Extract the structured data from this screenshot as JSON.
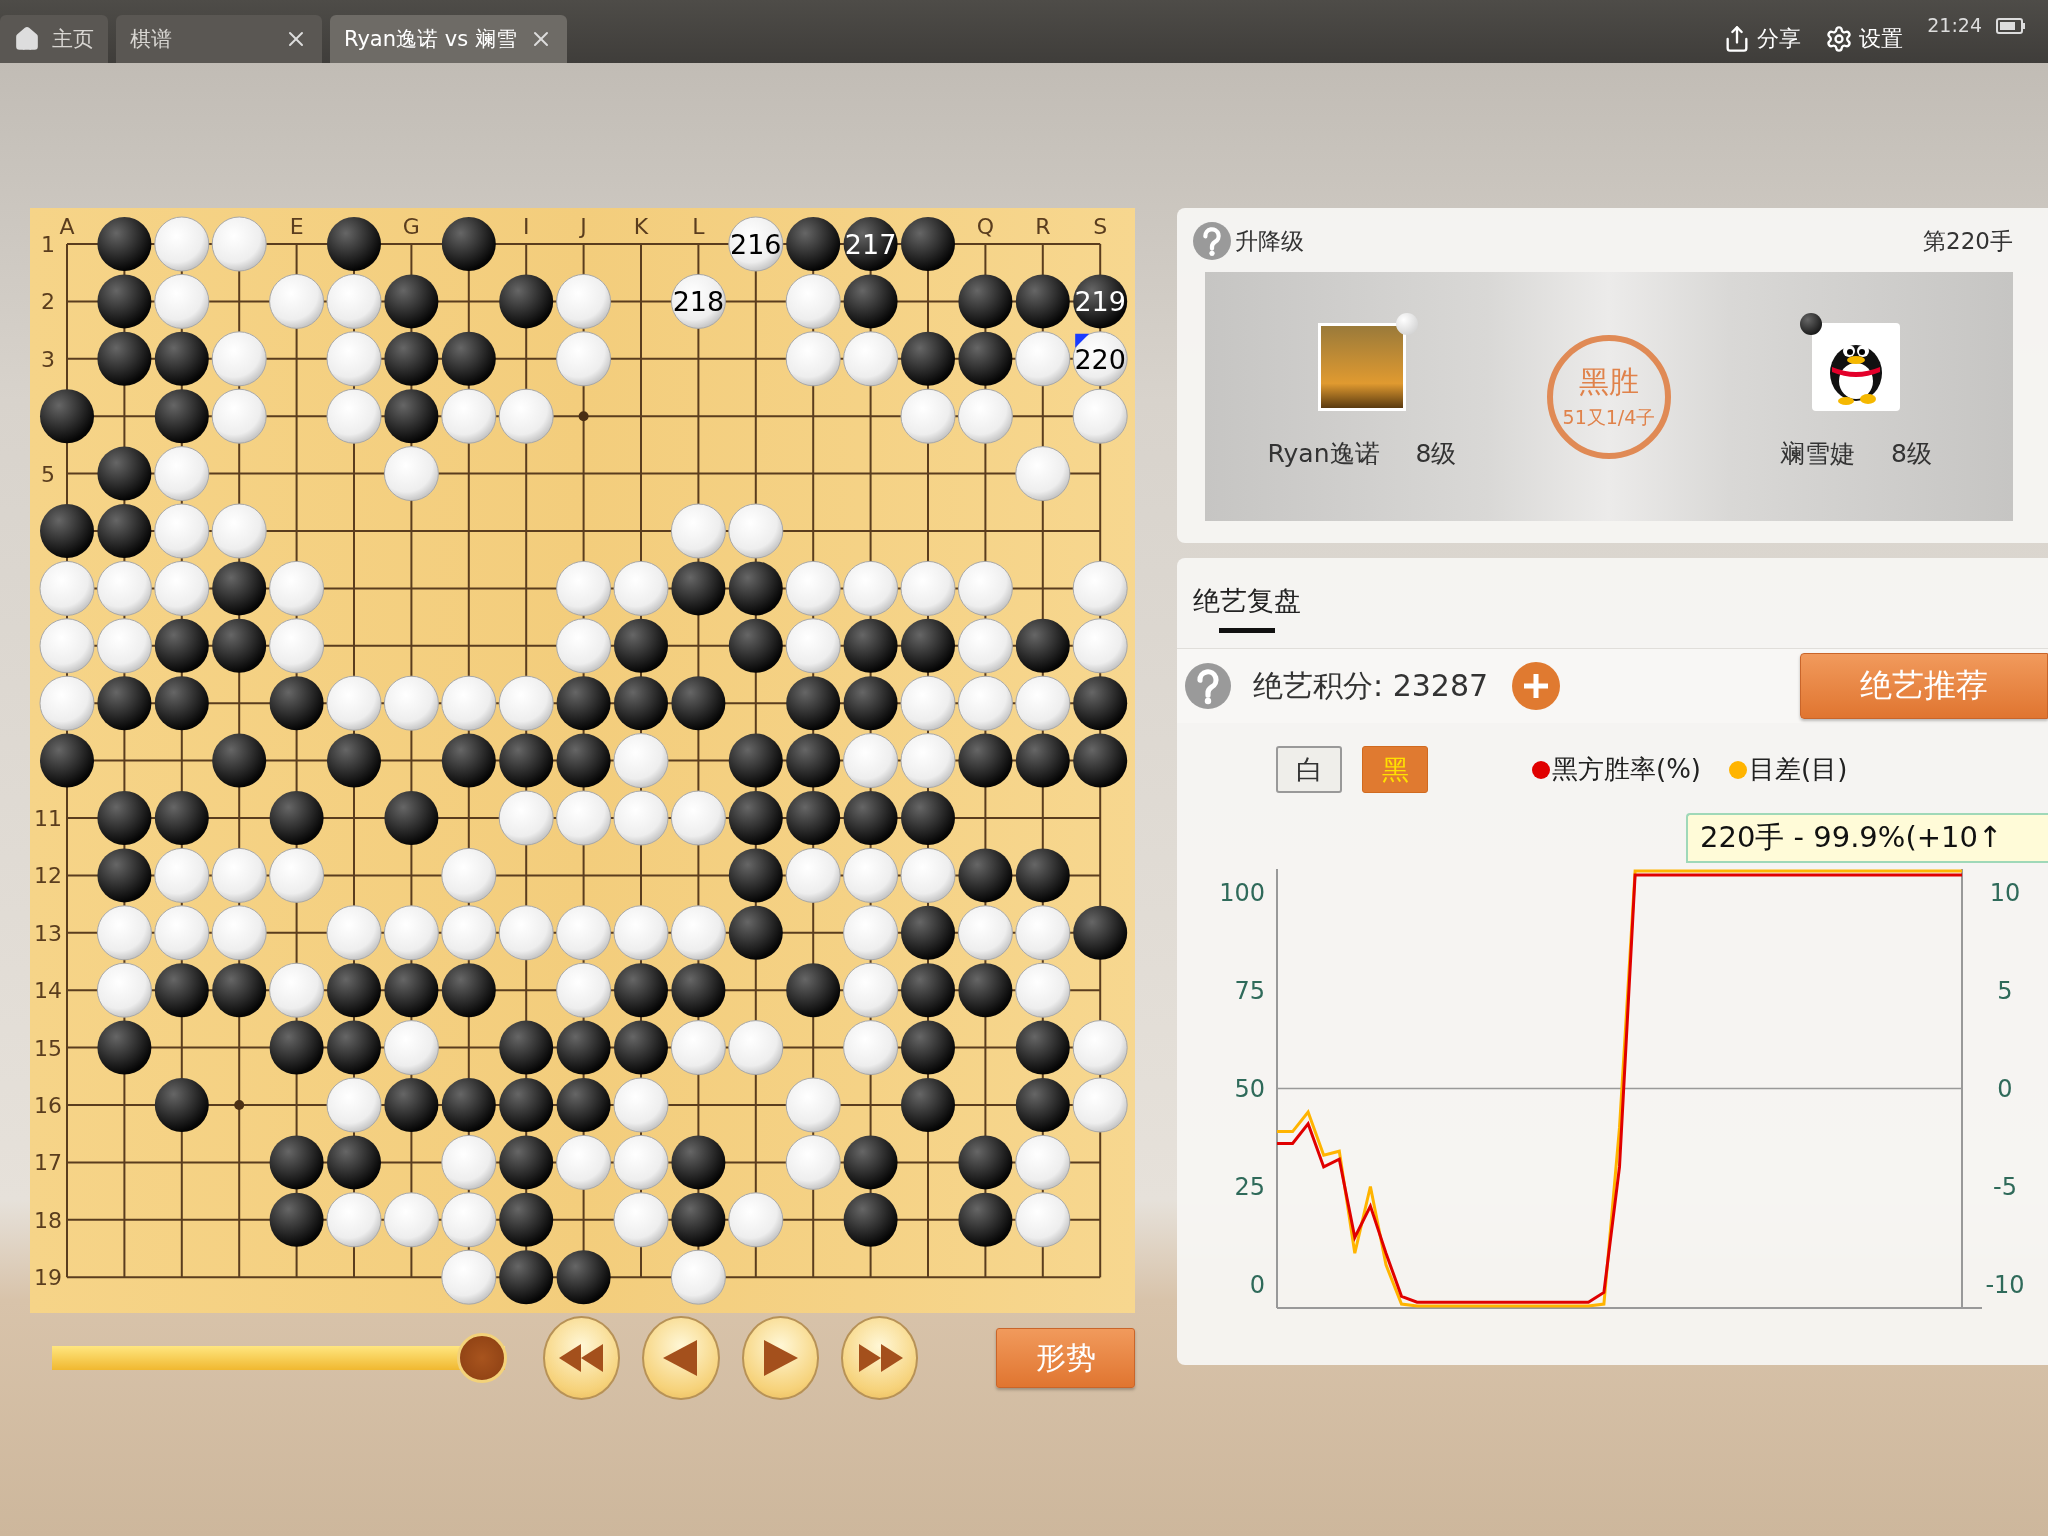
{
  "tabs": [
    {
      "kind": "home",
      "label": "主页",
      "selected": false,
      "closable": false
    },
    {
      "kind": "page",
      "label": "棋谱",
      "selected": false,
      "closable": true
    },
    {
      "kind": "page",
      "label": "Ryan逸诺 vs 斓雪",
      "selected": true,
      "closable": true
    }
  ],
  "toolbar": [
    {
      "kind": "share",
      "label": "分享"
    },
    {
      "kind": "settings",
      "label": "设置"
    }
  ],
  "status": {
    "time": "21:24"
  },
  "board": {
    "column_labels": [
      {
        "kind": "label",
        "text": "A"
      },
      {
        "kind": "covered"
      },
      {
        "kind": "covered"
      },
      {
        "kind": "covered"
      },
      {
        "kind": "label",
        "text": "E"
      },
      {
        "kind": "covered"
      },
      {
        "kind": "label",
        "text": "G"
      },
      {
        "kind": "covered"
      },
      {
        "kind": "label",
        "text": "I"
      },
      {
        "kind": "label",
        "text": "J"
      },
      {
        "kind": "label",
        "text": "K"
      },
      {
        "kind": "label",
        "text": "L"
      },
      {
        "kind": "covered"
      },
      {
        "kind": "covered"
      },
      {
        "kind": "covered"
      },
      {
        "kind": "covered"
      },
      {
        "kind": "label",
        "text": "Q"
      },
      {
        "kind": "label",
        "text": "R"
      },
      {
        "kind": "label",
        "text": "S"
      }
    ],
    "row_labels": [
      {
        "kind": "label",
        "text": "1"
      },
      {
        "kind": "label",
        "text": "2"
      },
      {
        "kind": "label",
        "text": "3"
      },
      {
        "kind": "covered"
      },
      {
        "kind": "label",
        "text": "5"
      },
      {
        "kind": "covered"
      },
      {
        "kind": "covered"
      },
      {
        "kind": "covered"
      },
      {
        "kind": "covered"
      },
      {
        "kind": "covered"
      },
      {
        "kind": "label",
        "text": "11"
      },
      {
        "kind": "label",
        "text": "12"
      },
      {
        "kind": "label",
        "text": "13"
      },
      {
        "kind": "label",
        "text": "14"
      },
      {
        "kind": "label",
        "text": "15"
      },
      {
        "kind": "label",
        "text": "16"
      },
      {
        "kind": "label",
        "text": "17"
      },
      {
        "kind": "label",
        "text": "18"
      },
      {
        "kind": "label",
        "text": "19"
      }
    ],
    "rows": [
      {
        "cells": [
          {
            "kind": "empty"
          },
          {
            "kind": "black"
          },
          {
            "kind": "white"
          },
          {
            "kind": "white"
          },
          {
            "kind": "empty"
          },
          {
            "kind": "black"
          },
          {
            "kind": "empty"
          },
          {
            "kind": "black"
          },
          {
            "kind": "empty"
          },
          {
            "kind": "empty"
          },
          {
            "kind": "empty"
          },
          {
            "kind": "empty"
          },
          {
            "kind": "white",
            "number": "216"
          },
          {
            "kind": "black"
          },
          {
            "kind": "black",
            "number": "217"
          },
          {
            "kind": "black"
          },
          {
            "kind": "empty"
          },
          {
            "kind": "empty"
          },
          {
            "kind": "empty"
          }
        ]
      },
      {
        "cells": [
          {
            "kind": "empty"
          },
          {
            "kind": "black"
          },
          {
            "kind": "white"
          },
          {
            "kind": "empty"
          },
          {
            "kind": "white"
          },
          {
            "kind": "white"
          },
          {
            "kind": "black"
          },
          {
            "kind": "empty"
          },
          {
            "kind": "black"
          },
          {
            "kind": "white"
          },
          {
            "kind": "empty"
          },
          {
            "kind": "white",
            "number": "218"
          },
          {
            "kind": "empty"
          },
          {
            "kind": "white"
          },
          {
            "kind": "black"
          },
          {
            "kind": "empty"
          },
          {
            "kind": "black"
          },
          {
            "kind": "black"
          },
          {
            "kind": "black",
            "number": "219"
          }
        ]
      },
      {
        "cells": [
          {
            "kind": "empty"
          },
          {
            "kind": "black"
          },
          {
            "kind": "black"
          },
          {
            "kind": "white"
          },
          {
            "kind": "empty"
          },
          {
            "kind": "white"
          },
          {
            "kind": "black"
          },
          {
            "kind": "black"
          },
          {
            "kind": "empty"
          },
          {
            "kind": "white"
          },
          {
            "kind": "empty"
          },
          {
            "kind": "empty"
          },
          {
            "kind": "empty"
          },
          {
            "kind": "white"
          },
          {
            "kind": "white"
          },
          {
            "kind": "black"
          },
          {
            "kind": "black"
          },
          {
            "kind": "white"
          },
          {
            "kind": "white",
            "number": "220",
            "marked": true
          }
        ]
      },
      {
        "cells": [
          {
            "kind": "black"
          },
          {
            "kind": "empty"
          },
          {
            "kind": "black"
          },
          {
            "kind": "white"
          },
          {
            "kind": "empty"
          },
          {
            "kind": "white"
          },
          {
            "kind": "black"
          },
          {
            "kind": "white"
          },
          {
            "kind": "white"
          },
          {
            "kind": "empty"
          },
          {
            "kind": "empty"
          },
          {
            "kind": "empty"
          },
          {
            "kind": "empty"
          },
          {
            "kind": "empty"
          },
          {
            "kind": "empty"
          },
          {
            "kind": "white"
          },
          {
            "kind": "white"
          },
          {
            "kind": "empty"
          },
          {
            "kind": "white"
          }
        ]
      },
      {
        "cells": [
          {
            "kind": "empty"
          },
          {
            "kind": "black"
          },
          {
            "kind": "white"
          },
          {
            "kind": "empty"
          },
          {
            "kind": "empty"
          },
          {
            "kind": "empty"
          },
          {
            "kind": "white"
          },
          {
            "kind": "empty"
          },
          {
            "kind": "empty"
          },
          {
            "kind": "empty"
          },
          {
            "kind": "empty"
          },
          {
            "kind": "empty"
          },
          {
            "kind": "empty"
          },
          {
            "kind": "empty"
          },
          {
            "kind": "empty"
          },
          {
            "kind": "empty"
          },
          {
            "kind": "empty"
          },
          {
            "kind": "white"
          },
          {
            "kind": "empty"
          }
        ]
      },
      {
        "cells": [
          {
            "kind": "black"
          },
          {
            "kind": "black"
          },
          {
            "kind": "white"
          },
          {
            "kind": "white"
          },
          {
            "kind": "empty"
          },
          {
            "kind": "empty"
          },
          {
            "kind": "empty"
          },
          {
            "kind": "empty"
          },
          {
            "kind": "empty"
          },
          {
            "kind": "empty"
          },
          {
            "kind": "empty"
          },
          {
            "kind": "white"
          },
          {
            "kind": "white"
          },
          {
            "kind": "empty"
          },
          {
            "kind": "empty"
          },
          {
            "kind": "empty"
          },
          {
            "kind": "empty"
          },
          {
            "kind": "empty"
          },
          {
            "kind": "empty"
          }
        ]
      },
      {
        "cells": [
          {
            "kind": "white"
          },
          {
            "kind": "white"
          },
          {
            "kind": "white"
          },
          {
            "kind": "black"
          },
          {
            "kind": "white"
          },
          {
            "kind": "empty"
          },
          {
            "kind": "empty"
          },
          {
            "kind": "empty"
          },
          {
            "kind": "empty"
          },
          {
            "kind": "white"
          },
          {
            "kind": "white"
          },
          {
            "kind": "black"
          },
          {
            "kind": "black"
          },
          {
            "kind": "white"
          },
          {
            "kind": "white"
          },
          {
            "kind": "white"
          },
          {
            "kind": "white"
          },
          {
            "kind": "empty"
          },
          {
            "kind": "white"
          }
        ]
      },
      {
        "cells": [
          {
            "kind": "white"
          },
          {
            "kind": "white"
          },
          {
            "kind": "black"
          },
          {
            "kind": "black"
          },
          {
            "kind": "white"
          },
          {
            "kind": "empty"
          },
          {
            "kind": "empty"
          },
          {
            "kind": "empty"
          },
          {
            "kind": "empty"
          },
          {
            "kind": "white"
          },
          {
            "kind": "black"
          },
          {
            "kind": "empty"
          },
          {
            "kind": "black"
          },
          {
            "kind": "white"
          },
          {
            "kind": "black"
          },
          {
            "kind": "black"
          },
          {
            "kind": "white"
          },
          {
            "kind": "black"
          },
          {
            "kind": "white"
          }
        ]
      },
      {
        "cells": [
          {
            "kind": "white"
          },
          {
            "kind": "black"
          },
          {
            "kind": "black"
          },
          {
            "kind": "empty"
          },
          {
            "kind": "black"
          },
          {
            "kind": "white"
          },
          {
            "kind": "white"
          },
          {
            "kind": "white"
          },
          {
            "kind": "white"
          },
          {
            "kind": "black"
          },
          {
            "kind": "black"
          },
          {
            "kind": "black"
          },
          {
            "kind": "empty"
          },
          {
            "kind": "black"
          },
          {
            "kind": "black"
          },
          {
            "kind": "white"
          },
          {
            "kind": "white"
          },
          {
            "kind": "white"
          },
          {
            "kind": "black"
          }
        ]
      },
      {
        "cells": [
          {
            "kind": "black"
          },
          {
            "kind": "empty"
          },
          {
            "kind": "empty"
          },
          {
            "kind": "black"
          },
          {
            "kind": "empty"
          },
          {
            "kind": "black"
          },
          {
            "kind": "empty"
          },
          {
            "kind": "black"
          },
          {
            "kind": "black"
          },
          {
            "kind": "black"
          },
          {
            "kind": "white"
          },
          {
            "kind": "empty"
          },
          {
            "kind": "black"
          },
          {
            "kind": "black"
          },
          {
            "kind": "white"
          },
          {
            "kind": "white"
          },
          {
            "kind": "black"
          },
          {
            "kind": "black"
          },
          {
            "kind": "black"
          }
        ]
      },
      {
        "cells": [
          {
            "kind": "empty"
          },
          {
            "kind": "black"
          },
          {
            "kind": "black"
          },
          {
            "kind": "empty"
          },
          {
            "kind": "black"
          },
          {
            "kind": "empty"
          },
          {
            "kind": "black"
          },
          {
            "kind": "empty"
          },
          {
            "kind": "white"
          },
          {
            "kind": "white"
          },
          {
            "kind": "white"
          },
          {
            "kind": "white"
          },
          {
            "kind": "black"
          },
          {
            "kind": "black"
          },
          {
            "kind": "black"
          },
          {
            "kind": "black"
          },
          {
            "kind": "empty"
          },
          {
            "kind": "empty"
          },
          {
            "kind": "empty"
          }
        ]
      },
      {
        "cells": [
          {
            "kind": "empty"
          },
          {
            "kind": "black"
          },
          {
            "kind": "white"
          },
          {
            "kind": "white"
          },
          {
            "kind": "white"
          },
          {
            "kind": "empty"
          },
          {
            "kind": "empty"
          },
          {
            "kind": "white"
          },
          {
            "kind": "empty"
          },
          {
            "kind": "empty"
          },
          {
            "kind": "empty"
          },
          {
            "kind": "empty"
          },
          {
            "kind": "black"
          },
          {
            "kind": "white"
          },
          {
            "kind": "white"
          },
          {
            "kind": "white"
          },
          {
            "kind": "black"
          },
          {
            "kind": "black"
          },
          {
            "kind": "empty"
          }
        ]
      },
      {
        "cells": [
          {
            "kind": "empty"
          },
          {
            "kind": "white"
          },
          {
            "kind": "white"
          },
          {
            "kind": "white"
          },
          {
            "kind": "empty"
          },
          {
            "kind": "white"
          },
          {
            "kind": "white"
          },
          {
            "kind": "white"
          },
          {
            "kind": "white"
          },
          {
            "kind": "white"
          },
          {
            "kind": "white"
          },
          {
            "kind": "white"
          },
          {
            "kind": "black"
          },
          {
            "kind": "empty"
          },
          {
            "kind": "white"
          },
          {
            "kind": "black"
          },
          {
            "kind": "white"
          },
          {
            "kind": "white"
          },
          {
            "kind": "black"
          }
        ]
      },
      {
        "cells": [
          {
            "kind": "empty"
          },
          {
            "kind": "white"
          },
          {
            "kind": "black"
          },
          {
            "kind": "black"
          },
          {
            "kind": "white"
          },
          {
            "kind": "black"
          },
          {
            "kind": "black"
          },
          {
            "kind": "black"
          },
          {
            "kind": "empty"
          },
          {
            "kind": "white"
          },
          {
            "kind": "black"
          },
          {
            "kind": "black"
          },
          {
            "kind": "empty"
          },
          {
            "kind": "black"
          },
          {
            "kind": "white"
          },
          {
            "kind": "black"
          },
          {
            "kind": "black"
          },
          {
            "kind": "white"
          },
          {
            "kind": "empty"
          }
        ]
      },
      {
        "cells": [
          {
            "kind": "empty"
          },
          {
            "kind": "black"
          },
          {
            "kind": "empty"
          },
          {
            "kind": "empty"
          },
          {
            "kind": "black"
          },
          {
            "kind": "black"
          },
          {
            "kind": "white"
          },
          {
            "kind": "empty"
          },
          {
            "kind": "black"
          },
          {
            "kind": "black"
          },
          {
            "kind": "black"
          },
          {
            "kind": "white"
          },
          {
            "kind": "white"
          },
          {
            "kind": "empty"
          },
          {
            "kind": "white"
          },
          {
            "kind": "black"
          },
          {
            "kind": "empty"
          },
          {
            "kind": "black"
          },
          {
            "kind": "white"
          }
        ]
      },
      {
        "cells": [
          {
            "kind": "empty"
          },
          {
            "kind": "empty"
          },
          {
            "kind": "black"
          },
          {
            "kind": "empty"
          },
          {
            "kind": "empty"
          },
          {
            "kind": "white"
          },
          {
            "kind": "black"
          },
          {
            "kind": "black"
          },
          {
            "kind": "black"
          },
          {
            "kind": "black"
          },
          {
            "kind": "white"
          },
          {
            "kind": "empty"
          },
          {
            "kind": "empty"
          },
          {
            "kind": "white"
          },
          {
            "kind": "empty"
          },
          {
            "kind": "black"
          },
          {
            "kind": "empty"
          },
          {
            "kind": "black"
          },
          {
            "kind": "white"
          }
        ]
      },
      {
        "cells": [
          {
            "kind": "empty"
          },
          {
            "kind": "empty"
          },
          {
            "kind": "empty"
          },
          {
            "kind": "empty"
          },
          {
            "kind": "black"
          },
          {
            "kind": "black"
          },
          {
            "kind": "empty"
          },
          {
            "kind": "white"
          },
          {
            "kind": "black"
          },
          {
            "kind": "white"
          },
          {
            "kind": "white"
          },
          {
            "kind": "black"
          },
          {
            "kind": "empty"
          },
          {
            "kind": "white"
          },
          {
            "kind": "black"
          },
          {
            "kind": "empty"
          },
          {
            "kind": "black"
          },
          {
            "kind": "white"
          },
          {
            "kind": "empty"
          }
        ]
      },
      {
        "cells": [
          {
            "kind": "empty"
          },
          {
            "kind": "empty"
          },
          {
            "kind": "empty"
          },
          {
            "kind": "empty"
          },
          {
            "kind": "black"
          },
          {
            "kind": "white"
          },
          {
            "kind": "white"
          },
          {
            "kind": "white"
          },
          {
            "kind": "black"
          },
          {
            "kind": "empty"
          },
          {
            "kind": "white"
          },
          {
            "kind": "black"
          },
          {
            "kind": "white"
          },
          {
            "kind": "empty"
          },
          {
            "kind": "black"
          },
          {
            "kind": "empty"
          },
          {
            "kind": "black"
          },
          {
            "kind": "white"
          },
          {
            "kind": "empty"
          }
        ]
      },
      {
        "cells": [
          {
            "kind": "empty"
          },
          {
            "kind": "empty"
          },
          {
            "kind": "empty"
          },
          {
            "kind": "empty"
          },
          {
            "kind": "empty"
          },
          {
            "kind": "empty"
          },
          {
            "kind": "empty"
          },
          {
            "kind": "white"
          },
          {
            "kind": "black"
          },
          {
            "kind": "black"
          },
          {
            "kind": "empty"
          },
          {
            "kind": "white"
          },
          {
            "kind": "empty"
          },
          {
            "kind": "empty"
          },
          {
            "kind": "empty"
          },
          {
            "kind": "empty"
          },
          {
            "kind": "empty"
          },
          {
            "kind": "empty"
          },
          {
            "kind": "empty"
          }
        ]
      }
    ]
  },
  "playback": {
    "level": 1,
    "buttons": [
      {
        "kind": "first"
      },
      {
        "kind": "prev"
      },
      {
        "kind": "next"
      },
      {
        "kind": "last"
      }
    ],
    "analysis_button": "形势"
  },
  "game": {
    "help_label": "升降级",
    "move": "第220手",
    "players": [
      {
        "name": "Ryan逸诺",
        "rank": "8级",
        "stone": {
          "kind": "white"
        },
        "avatar": {
          "kind": "photo"
        }
      },
      {
        "name": "斓雪婕",
        "rank": "8级",
        "stone": {
          "kind": "black"
        },
        "avatar": {
          "kind": "penguin"
        }
      }
    ],
    "result": {
      "title": "黑胜",
      "detail": "51又1/4子"
    }
  },
  "review": {
    "tabs": [
      {
        "label": "绝艺复盘",
        "selected": true
      }
    ],
    "score": "绝艺积分: 23287",
    "recommend_button": "绝艺推荐",
    "side_toggle": [
      {
        "label": "白",
        "selected": false
      },
      {
        "label": "黑",
        "selected": true
      }
    ],
    "tooltip": "220手 - 99.9%(+10↑",
    "right_axis_labels": [
      "10",
      "5",
      "0",
      "-5",
      "-10"
    ],
    "chart_data": {
      "type": "line",
      "categories": [
        null,
        null,
        null,
        null,
        null,
        null,
        null,
        null,
        null,
        null,
        null,
        null,
        null,
        null,
        null,
        null,
        null,
        null,
        null,
        null,
        null,
        null,
        null,
        null,
        null,
        null,
        null,
        null,
        null,
        null,
        null,
        null,
        null,
        null,
        null,
        null,
        null,
        null,
        null,
        null,
        null,
        null,
        null,
        null,
        null
      ],
      "series": [
        {
          "name": "黑方胜率(%)",
          "color": "#e00000",
          "values": [
            36,
            36,
            41,
            30,
            32,
            12,
            20,
            8,
            -3,
            -4.5,
            -4.5,
            -4.5,
            -4.5,
            -4.5,
            -4.5,
            -4.5,
            -4.5,
            -4.5,
            -4.5,
            -4.5,
            -4.5,
            -2,
            30,
            104.5,
            104.5,
            104.5,
            104.5,
            104.5,
            104.5,
            104.5,
            104.5,
            104.5,
            104.5,
            104.5,
            104.5,
            104.5,
            104.5,
            104.5,
            104.5,
            104.5,
            104.5,
            104.5,
            104.5,
            104.5,
            104.5
          ]
        },
        {
          "name": "目差(目)",
          "color": "#ffb400",
          "values": [
            39,
            39,
            44,
            33,
            34,
            8,
            25,
            5,
            -5,
            -5.5,
            -5.5,
            -5.5,
            -5.5,
            -5.5,
            -5.5,
            -5.5,
            -5.5,
            -5.5,
            -5.5,
            -5.5,
            -5.5,
            -5,
            40,
            105.5,
            105.5,
            105.5,
            105.5,
            105.5,
            105.5,
            105.5,
            105.5,
            105.5,
            105.5,
            105.5,
            105.5,
            105.5,
            105.5,
            105.5,
            105.5,
            105.5,
            105.5,
            105.5,
            105.5,
            105.5,
            105.5
          ]
        }
      ],
      "ref_lines": [
        {
          "axis": "y",
          "value": 50
        }
      ],
      "ylim": [
        -6,
        106
      ],
      "yticks": [
        0,
        25,
        50,
        75,
        100
      ]
    }
  }
}
